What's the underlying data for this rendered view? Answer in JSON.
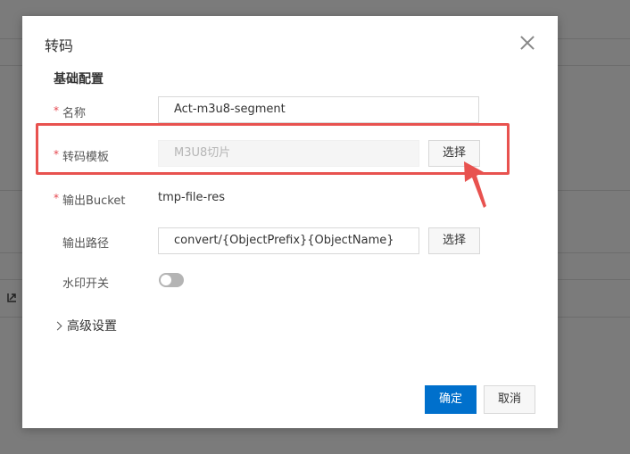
{
  "dialog": {
    "title": "转码",
    "section_title": "基础配置",
    "required_mark": "*",
    "fields": {
      "name": {
        "label": "名称",
        "value": "Act-m3u8-segment"
      },
      "template": {
        "label": "转码模板",
        "value": "M3U8切片",
        "button": "选择"
      },
      "bucket": {
        "label": "输出Bucket",
        "value": "tmp-file-res"
      },
      "path": {
        "label": "输出路径",
        "value": "convert/{ObjectPrefix}{ObjectName}",
        "button": "选择"
      },
      "watermark": {
        "label": "水印开关",
        "enabled": false
      }
    },
    "advanced": "高级设置",
    "ok": "确定",
    "cancel": "取消"
  },
  "colors": {
    "primary": "#0070cc",
    "annotation": "#e8524f",
    "required": "#e5454d"
  },
  "icons": {
    "close": "close-icon",
    "advanced": "chevron-right-icon",
    "background": "export-icon"
  }
}
